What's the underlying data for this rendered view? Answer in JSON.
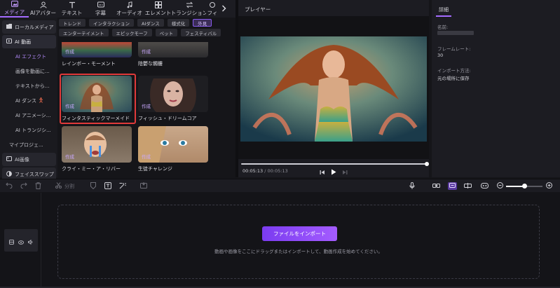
{
  "toolbar": {
    "tabs": [
      {
        "label": "メディア",
        "icon": "media-icon"
      },
      {
        "label": "AIアバター",
        "icon": "avatar-icon"
      },
      {
        "label": "テキスト",
        "icon": "text-icon"
      },
      {
        "label": "字幕",
        "icon": "subtitle-icon"
      },
      {
        "label": "オーディオ",
        "icon": "audio-icon"
      },
      {
        "label": "エレメント",
        "icon": "element-icon"
      },
      {
        "label": "トランジション",
        "icon": "transition-icon"
      },
      {
        "label": "フィ",
        "icon": "filter-icon"
      }
    ]
  },
  "leftnav": {
    "local_media": "ローカルメディア",
    "ai_video": "AI 動画",
    "items": [
      "AI エフェクト",
      "画像を動画に...",
      "テキストから...",
      "AI ダンス",
      "AI アニメーシ...",
      "AI トランジシ...",
      "マイプロジェ..."
    ],
    "ai_image": "AI画像",
    "face_swap": "フェイススワップ"
  },
  "chips": {
    "row1": [
      "トレンド",
      "インタラクション",
      "AIダンス",
      "様式化",
      "外見"
    ],
    "row2": [
      "エンターテイメント",
      "エピックモーフ",
      "ペット",
      "フェスティバル"
    ]
  },
  "grid": {
    "make_label": "作成",
    "cards": [
      {
        "caption": "レインボー・モーメント"
      },
      {
        "caption": "陰鬱な髑髏"
      },
      {
        "caption": "フィンタスティックマーメイド"
      },
      {
        "caption": "フィッシュ・ドリームコア"
      },
      {
        "caption": "クライ・ミー・ア・リバー"
      },
      {
        "caption": "生徒チャレンジ"
      }
    ]
  },
  "player": {
    "title": "プレイヤー",
    "current_time": "00:05:13",
    "separator": " / ",
    "total_time": "00:05:13",
    "progress": 1.0
  },
  "details": {
    "tab": "詳細",
    "name_label": "名前:",
    "framerate_label": "フレームレート:",
    "framerate_value": "30",
    "import_label": "インポート方法:",
    "import_value": "元の場所に保存"
  },
  "timeline": {
    "split_label": "分割",
    "zoom_level": 0.5,
    "import_button": "ファイルをインポート",
    "drop_hint": "動画や画像をここにドラッグまたはインポートして、動画作成を始めてください。"
  },
  "colors": {
    "accent": "#a46bff",
    "selection": "#e03a3a",
    "background": "#151519"
  }
}
